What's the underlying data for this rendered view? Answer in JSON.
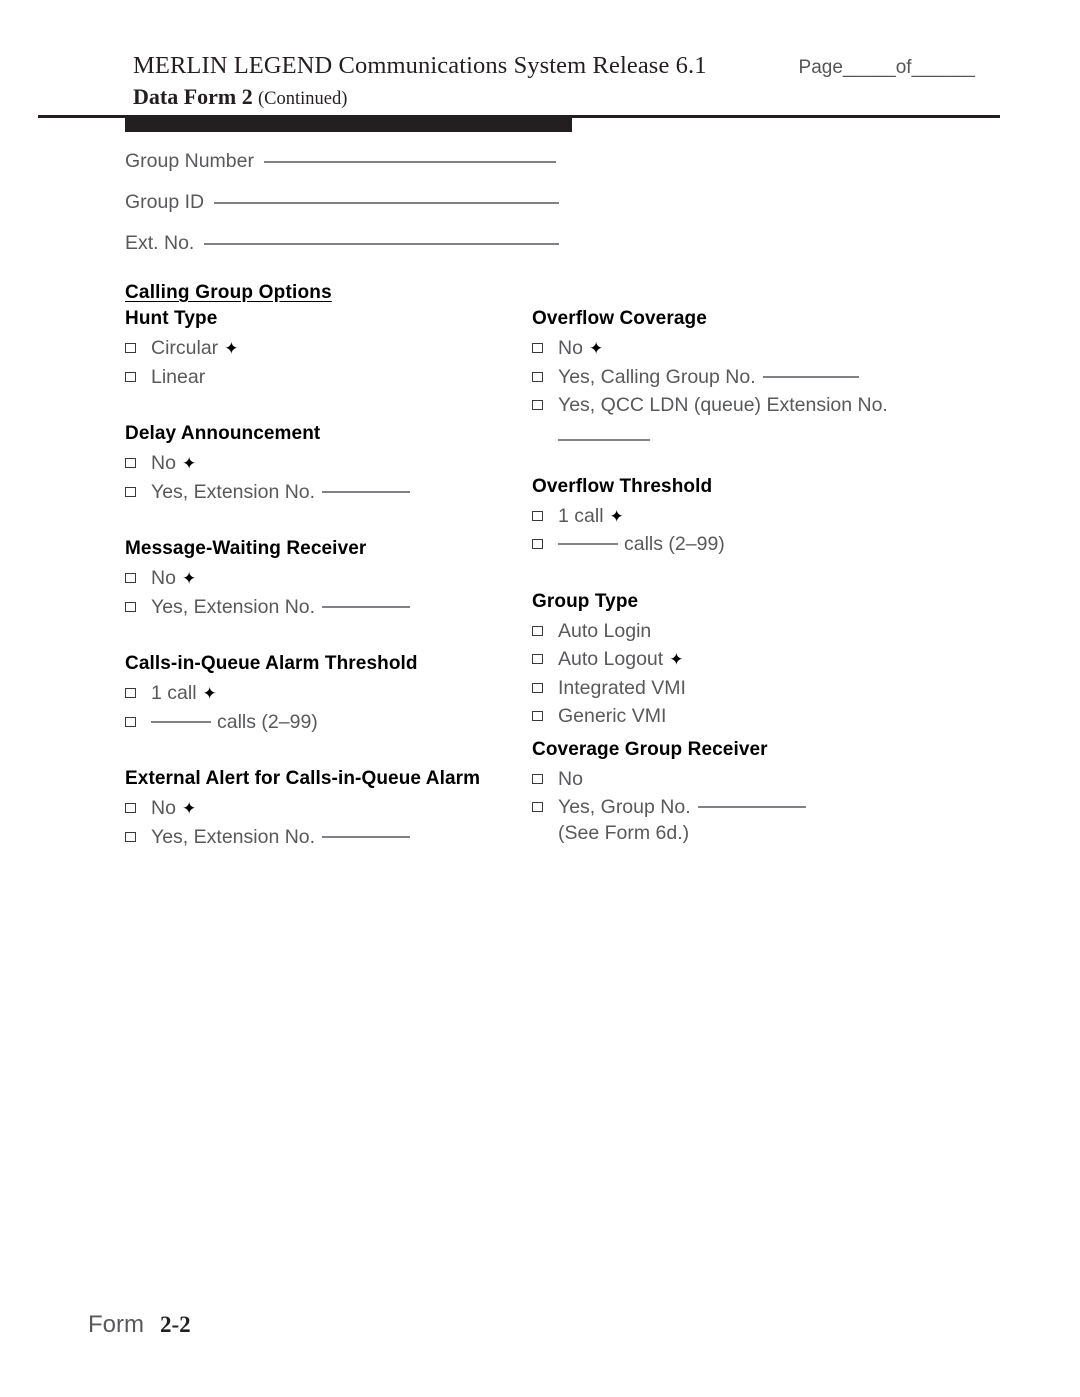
{
  "header": {
    "title_line1": "MERLIN LEGEND Communications System Release 6.1",
    "form_name": "Data Form 2",
    "continued": "(Continued)",
    "page_field": "Page_____of______"
  },
  "top_fields": [
    {
      "label": "Group Number",
      "value": ""
    },
    {
      "label": "Group ID",
      "value": ""
    },
    {
      "label": "Ext. No.",
      "value": ""
    }
  ],
  "section": {
    "title": "Calling Group Options"
  },
  "glyphs": {
    "checkbox": "checkbox-empty-icon",
    "default_marker": "✦"
  },
  "left_column": {
    "hunt_type": {
      "heading": "Hunt Type",
      "options": [
        {
          "label": "Circular",
          "default": true
        },
        {
          "label": "Linear",
          "default": false
        }
      ]
    },
    "delay_announcement": {
      "heading": "Delay Announcement",
      "options": [
        {
          "label": "No",
          "default": true
        },
        {
          "label": "Yes, Extension No.",
          "default": false,
          "blank": true
        }
      ]
    },
    "message_waiting_receiver": {
      "heading": "Message-Waiting Receiver",
      "options": [
        {
          "label": "No",
          "default": true
        },
        {
          "label": "Yes, Extension No.",
          "default": false,
          "blank": true
        }
      ]
    },
    "calls_in_queue_alarm_threshold": {
      "heading": "Calls-in-Queue Alarm Threshold",
      "options": [
        {
          "label": "1 call",
          "default": true
        },
        {
          "label_after_blank": "calls (2–99)",
          "default": false,
          "blank_first": true
        }
      ]
    },
    "external_alert": {
      "heading": "External Alert for Calls-in-Queue Alarm",
      "options": [
        {
          "label": "No",
          "default": true
        },
        {
          "label": "Yes, Extension No.",
          "default": false,
          "blank": true
        }
      ]
    }
  },
  "right_column": {
    "overflow_coverage": {
      "heading": "Overflow Coverage",
      "options": [
        {
          "label": "No",
          "default": true
        },
        {
          "label": "Yes, Calling Group No.",
          "default": false,
          "blank": true
        },
        {
          "label": "Yes, QCC LDN (queue) Extension No.",
          "default": false,
          "blank_below": true
        }
      ]
    },
    "overflow_threshold": {
      "heading": "Overflow Threshold",
      "options": [
        {
          "label": "1 call",
          "default": true
        },
        {
          "label_after_blank": "calls (2–99)",
          "default": false,
          "blank_first": true
        }
      ]
    },
    "group_type": {
      "heading": "Group Type",
      "options": [
        {
          "label": "Auto Login",
          "default": false
        },
        {
          "label": "Auto Logout",
          "default": true
        },
        {
          "label": "Integrated VMI",
          "default": false
        },
        {
          "label": "Generic VMI",
          "default": false
        }
      ]
    },
    "coverage_group_receiver": {
      "heading": "Coverage Group Receiver",
      "options": [
        {
          "label": "No",
          "default": false
        },
        {
          "label": "Yes, Group No.",
          "default": false,
          "blank": true
        }
      ],
      "note": "(See Form 6d.)"
    }
  },
  "footer": {
    "word": "Form",
    "number": "2-2"
  }
}
